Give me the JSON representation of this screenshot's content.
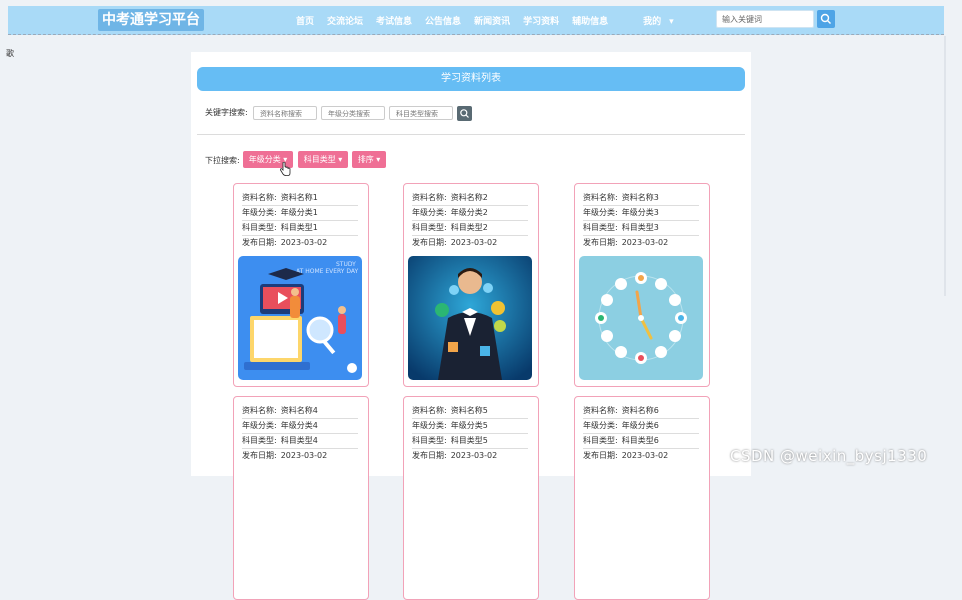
{
  "header": {
    "logo": "中考通学习平台",
    "nav": [
      "首页",
      "交流论坛",
      "考试信息",
      "公告信息",
      "新闻资讯",
      "学习资料",
      "辅助信息"
    ],
    "mine": "我的",
    "search_placeholder": "输入关键词"
  },
  "side_text": "歌",
  "list": {
    "title": "学习资料列表",
    "keyword_label": "关键字搜索:",
    "keyword_inputs": [
      "资料名称搜索",
      "年级分类搜索",
      "科目类型搜索"
    ],
    "dropdown_label": "下拉搜索:",
    "dropdowns": [
      "年级分类 ▾",
      "科目类型 ▾",
      "排序 ▾"
    ]
  },
  "labels": {
    "name": "资料名称:",
    "grade": "年级分类:",
    "subject": "科目类型:",
    "date": "发布日期:"
  },
  "cards": [
    {
      "name": "资料名称1",
      "grade": "年级分类1",
      "subject": "科目类型1",
      "date": "2023-03-02"
    },
    {
      "name": "资料名称2",
      "grade": "年级分类2",
      "subject": "科目类型2",
      "date": "2023-03-02"
    },
    {
      "name": "资料名称3",
      "grade": "年级分类3",
      "subject": "科目类型3",
      "date": "2023-03-02"
    },
    {
      "name": "资料名称4",
      "grade": "年级分类4",
      "subject": "科目类型4",
      "date": "2023-03-02"
    },
    {
      "name": "资料名称5",
      "grade": "年级分类5",
      "subject": "科目类型5",
      "date": "2023-03-02"
    },
    {
      "name": "资料名称6",
      "grade": "年级分类6",
      "subject": "科目类型6",
      "date": "2023-03-02"
    }
  ],
  "card1_image_text": {
    "line1": "STUDY",
    "line2": "AT HOME EVERY DAY"
  },
  "watermark": "CSDN @weixin_bysj1330",
  "colors": {
    "accent": "#66bdf4",
    "pink": "#ef6f95",
    "header_bg": "#a9daf7"
  }
}
